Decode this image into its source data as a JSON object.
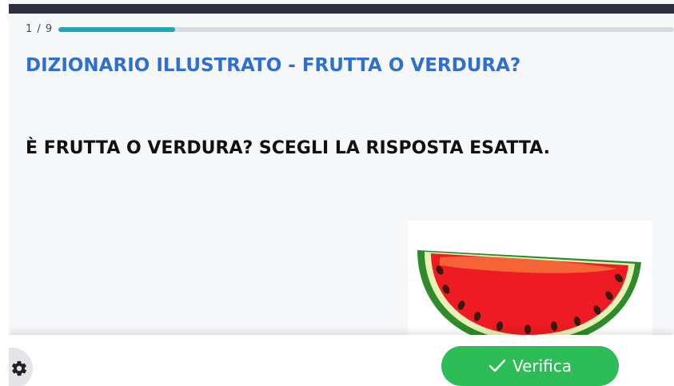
{
  "progress": {
    "counter": "1 / 9",
    "fraction": 0.19
  },
  "header": {
    "title": "DIZIONARIO ILLUSTRATO - FRUTTA O VERDURA?"
  },
  "question": {
    "text": "È FRUTTA O VERDURA? SCEGLI LA RISPOSTA ESATTA."
  },
  "image": {
    "subject": "watermelon-slice"
  },
  "footer": {
    "settings_icon": "gear-icon",
    "verify_label": "Verifica",
    "verify_icon": "checkmark-icon"
  },
  "colors": {
    "topbar": "#2b2f3f",
    "progress_fill": "#20a5b9",
    "title": "#2f6fd0",
    "verify_button": "#2dbd57"
  }
}
